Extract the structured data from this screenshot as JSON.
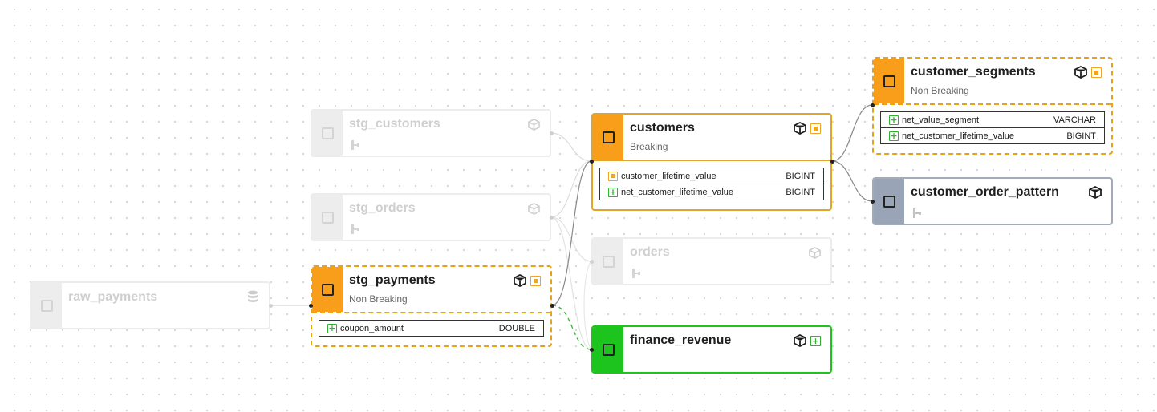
{
  "nodes": {
    "raw_payments": {
      "title": "raw_payments",
      "icon": "database-icon"
    },
    "stg_customers": {
      "title": "stg_customers",
      "icon": "cube-icon"
    },
    "stg_orders": {
      "title": "stg_orders",
      "icon": "cube-icon"
    },
    "stg_payments": {
      "title": "stg_payments",
      "subtitle": "Non Breaking",
      "columns": [
        {
          "name": "coupon_amount",
          "type": "DOUBLE",
          "change": "added"
        }
      ]
    },
    "customers": {
      "title": "customers",
      "subtitle": "Breaking",
      "columns": [
        {
          "name": "customer_lifetime_value",
          "type": "BIGINT",
          "change": "modified"
        },
        {
          "name": "net_customer_lifetime_value",
          "type": "BIGINT",
          "change": "added"
        }
      ]
    },
    "orders": {
      "title": "orders",
      "icon": "cube-icon"
    },
    "finance_revenue": {
      "title": "finance_revenue",
      "change": "added"
    },
    "customer_segments": {
      "title": "customer_segments",
      "subtitle": "Non Breaking",
      "columns": [
        {
          "name": "net_value_segment",
          "type": "VARCHAR",
          "change": "added"
        },
        {
          "name": "net_customer_lifetime_value",
          "type": "BIGINT",
          "change": "added"
        }
      ]
    },
    "customer_order_pattern": {
      "title": "customer_order_pattern"
    }
  },
  "colors": {
    "modified": "#f89e1b",
    "added": "#1ec41e",
    "unchanged": "#99a4b6",
    "faded": "#ededed"
  }
}
